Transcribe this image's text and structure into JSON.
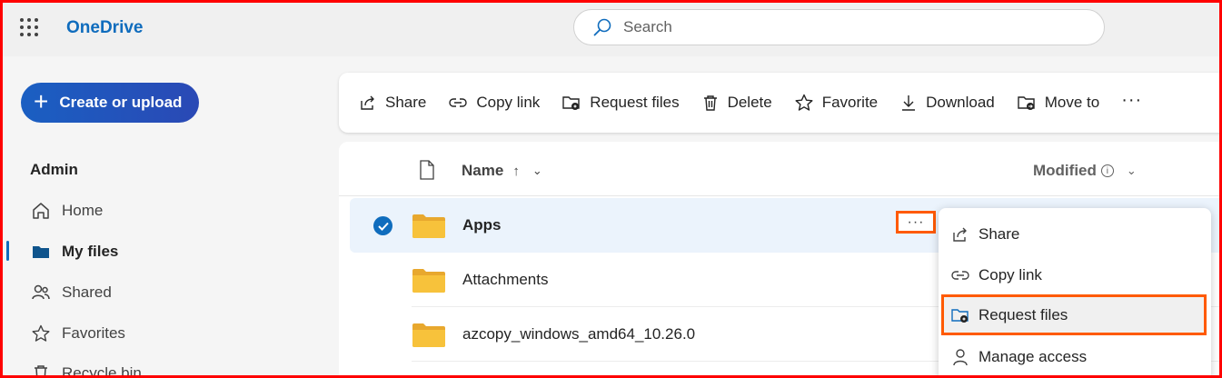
{
  "app": {
    "title": "OneDrive"
  },
  "search": {
    "placeholder": "Search"
  },
  "sidebar": {
    "create_label": "Create or upload",
    "section_label": "Admin",
    "items": [
      {
        "label": "Home",
        "icon": "home-icon"
      },
      {
        "label": "My files",
        "icon": "folder-icon",
        "active": true
      },
      {
        "label": "Shared",
        "icon": "people-icon"
      },
      {
        "label": "Favorites",
        "icon": "star-icon"
      },
      {
        "label": "Recycle bin",
        "icon": "trash-icon"
      }
    ]
  },
  "toolbar": {
    "share": "Share",
    "copy_link": "Copy link",
    "request_files": "Request files",
    "delete": "Delete",
    "favorite": "Favorite",
    "download": "Download",
    "move_to": "Move to",
    "more": "···"
  },
  "list": {
    "columns": {
      "name": "Name",
      "modified": "Modified"
    },
    "rows": [
      {
        "name": "Apps",
        "selected": true
      },
      {
        "name": "Attachments",
        "selected": false
      },
      {
        "name": "azcopy_windows_amd64_10.26.0",
        "selected": false
      }
    ],
    "more_label": "···"
  },
  "context_menu": {
    "items": [
      {
        "label": "Share"
      },
      {
        "label": "Copy link"
      },
      {
        "label": "Request files",
        "highlighted": true
      },
      {
        "label": "Manage access"
      }
    ]
  },
  "colors": {
    "accent": "#0f6cbd",
    "highlight_border": "#ff5a00",
    "frame_border": "#ff0000",
    "folder": "#f7c23b"
  }
}
